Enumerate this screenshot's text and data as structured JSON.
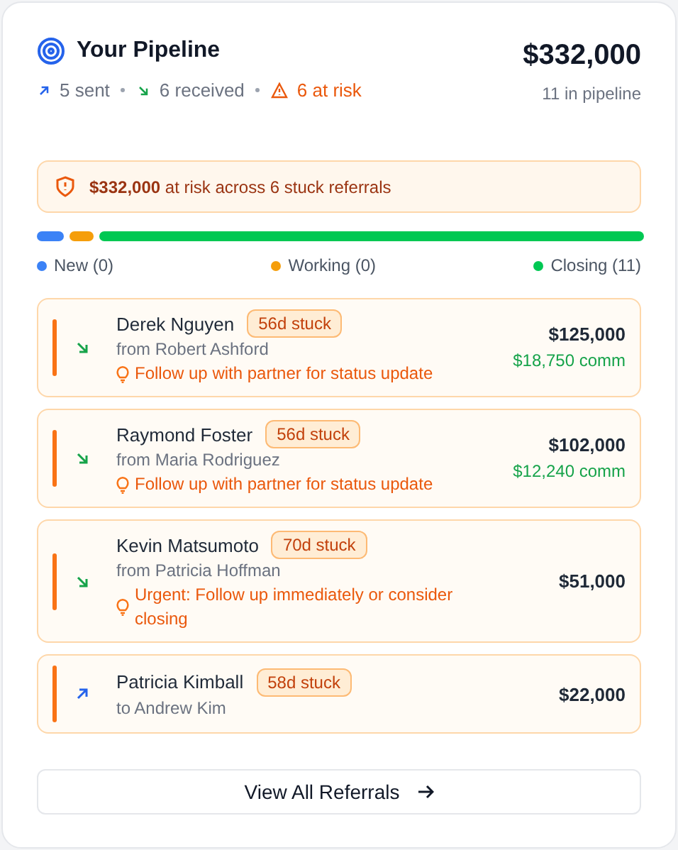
{
  "header": {
    "title": "Your Pipeline",
    "stats": [
      {
        "kind": "sent",
        "text": "5 sent"
      },
      {
        "kind": "received",
        "text": "6 received"
      },
      {
        "kind": "risk",
        "text": "6 at risk"
      }
    ],
    "total": "$332,000",
    "total_caption": "11 in pipeline"
  },
  "alert": {
    "text": "**$332,000** at risk across 6 stuck referrals"
  },
  "stages": [
    {
      "label": "New (0)",
      "color": "#3b82f6"
    },
    {
      "label": "Working (0)",
      "color": "#f59e0b"
    },
    {
      "label": "Closing (11)",
      "color": "#00c853"
    }
  ],
  "referrals": [
    {
      "kind": "received",
      "name": "Derek Nguyen",
      "badge": "56d stuck",
      "party": "from Robert Ashford",
      "tip": "Follow up with partner for status update",
      "amount": "$125,000",
      "commission": "$18,750 comm"
    },
    {
      "kind": "received",
      "name": "Raymond Foster",
      "badge": "56d stuck",
      "party": "from Maria Rodriguez",
      "tip": "Follow up with partner for status update",
      "amount": "$102,000",
      "commission": "$12,240 comm"
    },
    {
      "kind": "received",
      "name": "Kevin Matsumoto",
      "badge": "70d stuck",
      "party": "from Patricia Hoffman",
      "tip": "Urgent: Follow up immediately or consider closing",
      "amount": "$51,000"
    },
    {
      "kind": "sent",
      "name": "Patricia Kimball",
      "badge": "58d stuck",
      "party": "to Andrew Kim",
      "amount": "$22,000"
    }
  ],
  "button": {
    "label": "View All Referrals"
  }
}
